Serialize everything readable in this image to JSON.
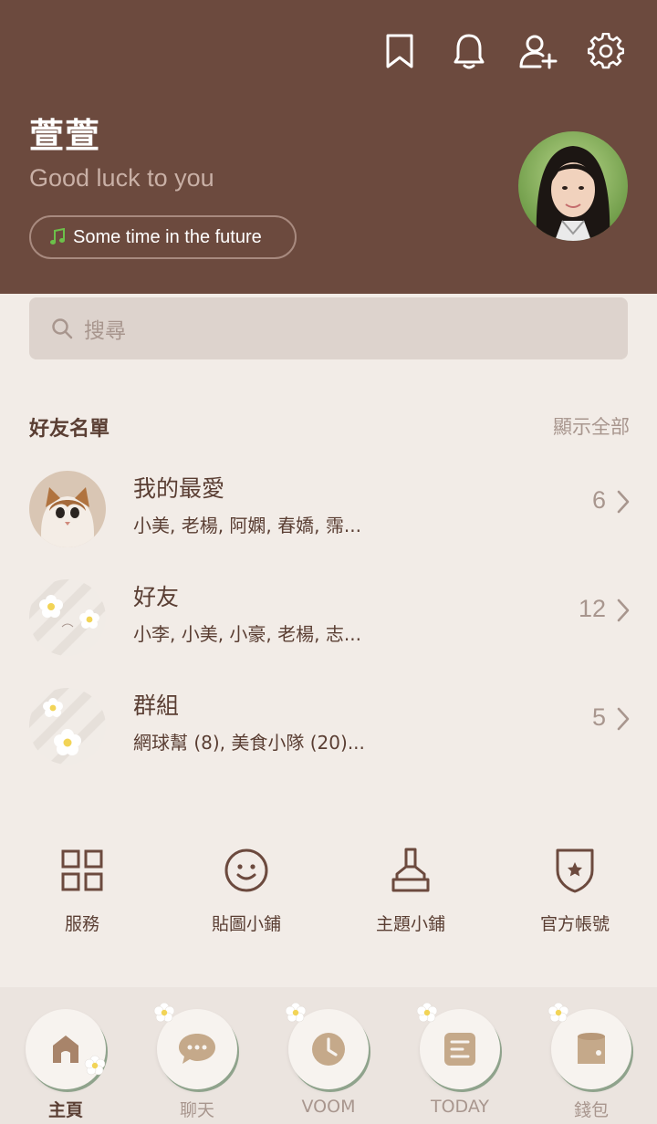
{
  "header": {
    "profile_name": "萱萱",
    "status_message": "Good luck to you",
    "music": "Some time in the future",
    "icons": [
      "bookmark-icon",
      "bell-icon",
      "add-friend-icon",
      "gear-icon"
    ]
  },
  "search": {
    "placeholder": "搜尋"
  },
  "friends_section": {
    "title": "好友名單",
    "show_all": "顯示全部",
    "rows": [
      {
        "title": "我的最愛",
        "subtitle": "小美, 老楊, 阿嫻, 春嬌, 霈...",
        "count": "6"
      },
      {
        "title": "好友",
        "subtitle": "小李, 小美, 小豪, 老楊, 志...",
        "count": "12"
      },
      {
        "title": "群組",
        "subtitle": "網球幫 (8), 美食小隊 (20)...",
        "count": "5"
      }
    ]
  },
  "shortcuts": [
    {
      "label": "服務",
      "icon": "grid-icon"
    },
    {
      "label": "貼圖小鋪",
      "icon": "smiley-icon"
    },
    {
      "label": "主題小鋪",
      "icon": "brush-icon"
    },
    {
      "label": "官方帳號",
      "icon": "shield-star-icon"
    }
  ],
  "bottom_nav": [
    {
      "label": "主頁",
      "icon": "home-icon",
      "active": true
    },
    {
      "label": "聊天",
      "icon": "chat-icon",
      "active": false
    },
    {
      "label": "VOOM",
      "icon": "clock-icon",
      "active": false
    },
    {
      "label": "TODAY",
      "icon": "news-icon",
      "active": false
    },
    {
      "label": "錢包",
      "icon": "wallet-icon",
      "active": false
    }
  ],
  "colors": {
    "header_bg": "#6c4a3e",
    "page_bg": "#f2ece7",
    "text_primary": "#5a3e33",
    "text_secondary": "#a8968e",
    "music_note": "#6cc04a"
  }
}
